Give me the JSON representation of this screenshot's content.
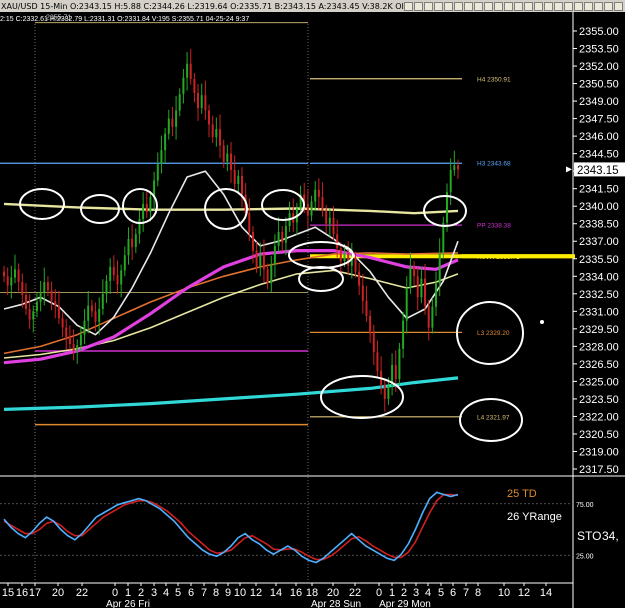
{
  "header": {
    "info": "XAU/USD 15-Min O:2343.15 H:5.88 C:2344.26 L:2319.64 O:2335.71 B:2343.15 A:2343.45 V:38.2K OI:",
    "sub": "2:15 C:2332.61 H:2332.79 L:2331.31 O:2331.84 V:195 S:2355.71 04-25-24 9:37",
    "icons": [
      "",
      "",
      "",
      "",
      "",
      "",
      "",
      "",
      "",
      "",
      "",
      "",
      "",
      "",
      "",
      "",
      "",
      "",
      "",
      "",
      "",
      ""
    ]
  },
  "colors": {
    "background": "#000000",
    "up_candle": "#22aa22",
    "down_candle": "#cc2222",
    "pivot_blue": "#5aa8ff",
    "pivot_magenta": "#d030d0",
    "pivot_orange": "#e08a30",
    "ma_white": "#e8e8e8",
    "ma_yellow": "#e6e6a0",
    "ma_magenta": "#e040e0",
    "ma_orange": "#e07030",
    "ma_cyan": "#30d8d8",
    "highlight_yellow": "#ffee00"
  },
  "chart_data": {
    "type": "candlestick",
    "title": "XAU/USD 15-Min",
    "ylim": [
      2317.5,
      2355.0
    ],
    "y_ticks": [
      "2355.00",
      "2353.50",
      "2352.00",
      "2350.50",
      "2349.00",
      "2347.50",
      "2346.00",
      "2344.50",
      "2343.00",
      "2341.50",
      "2340.00",
      "2338.50",
      "2337.00",
      "2335.50",
      "2334.00",
      "2332.50",
      "2331.00",
      "2329.50",
      "2328.00",
      "2326.50",
      "2325.00",
      "2323.50",
      "2322.00",
      "2320.50",
      "2319.00",
      "2317.50"
    ],
    "y_tick_values": [
      2355.0,
      2353.5,
      2352.0,
      2350.5,
      2349.0,
      2347.5,
      2346.0,
      2344.5,
      2343.0,
      2341.5,
      2340.0,
      2338.5,
      2337.0,
      2335.5,
      2334.0,
      2332.5,
      2331.0,
      2329.5,
      2328.0,
      2326.5,
      2325.0,
      2323.5,
      2322.0,
      2320.5,
      2319.0,
      2317.5
    ],
    "last_price": "2343.15",
    "last_price_value": 2343.15,
    "x_tick_labels": [
      "15",
      "16",
      "17",
      "20",
      "22",
      "0",
      "1",
      "2",
      "3",
      "4",
      "5",
      "6",
      "7",
      "8",
      "9",
      "10",
      "12",
      "14",
      "16",
      "18",
      "20",
      "22",
      "0",
      "1",
      "2",
      "3",
      "4",
      "5",
      "6",
      "7",
      "8",
      "10",
      "12",
      "14"
    ],
    "date_labels": [
      "Apr 26 Fri",
      "Apr 28 Sun",
      "Apr 29 Mon"
    ],
    "top_label": "2355.71",
    "pivots": [
      {
        "label": "H4 2350.91",
        "value": 2350.91,
        "color": "#d9c27a"
      },
      {
        "label": "H3 2343.68",
        "value": 2343.68,
        "color": "#5aa8ff"
      },
      {
        "label": "PP 2338.38",
        "value": 2338.38,
        "color": "#d030d0"
      },
      {
        "label": "R0VR 2335.71",
        "value": 2335.71,
        "color": "#ffee00"
      },
      {
        "label": "L3 2329.20",
        "value": 2329.2,
        "color": "#e08a30"
      },
      {
        "label": "L4 2321.97",
        "value": 2321.97,
        "color": "#d9c27a"
      }
    ],
    "prior_levels": [
      {
        "value": 2343.68,
        "color": "#5aa8ff"
      },
      {
        "value": 2327.6,
        "color": "#d030d0"
      },
      {
        "value": 2332.6,
        "color": "#d9c27a"
      },
      {
        "value": 2321.3,
        "color": "#e08a30"
      },
      {
        "value": 2355.71,
        "color": "#d9c27a"
      }
    ],
    "candles": [
      2334.0,
      2333.2,
      2333.9,
      2334.6,
      2333.5,
      2332.4,
      2331.2,
      2330.3,
      2331.0,
      2331.8,
      2332.6,
      2333.5,
      2332.8,
      2331.9,
      2331.5,
      2330.4,
      2329.6,
      2328.8,
      2328.2,
      2327.6,
      2328.1,
      2329.0,
      2330.2,
      2331.5,
      2331.0,
      2330.1,
      2331.2,
      2332.5,
      2333.6,
      2334.8,
      2334.1,
      2333.3,
      2334.5,
      2335.8,
      2337.2,
      2336.5,
      2337.6,
      2338.9,
      2340.2,
      2339.5,
      2340.8,
      2342.2,
      2343.6,
      2344.8,
      2346.2,
      2347.5,
      2346.8,
      2348.2,
      2349.6,
      2351.0,
      2352.2,
      2350.9,
      2349.7,
      2348.4,
      2349.5,
      2348.2,
      2347.0,
      2345.9,
      2346.6,
      2345.2,
      2343.8,
      2344.5,
      2343.1,
      2341.9,
      2342.6,
      2341.0,
      2339.4,
      2337.8,
      2336.2,
      2334.8,
      2335.9,
      2334.6,
      2333.4,
      2335.0,
      2336.6,
      2337.8,
      2336.9,
      2338.3,
      2339.4,
      2338.6,
      2339.8,
      2341.0,
      2340.2,
      2339.2,
      2340.4,
      2341.4,
      2340.8,
      2339.6,
      2338.5,
      2339.0,
      2337.6,
      2336.4,
      2335.3,
      2336.0,
      2334.9,
      2335.6,
      2334.4,
      2333.2,
      2331.9,
      2330.6,
      2329.1,
      2327.5,
      2325.9,
      2324.7,
      2323.5,
      2324.6,
      2326.4,
      2325.2,
      2327.8,
      2330.2,
      2333.0,
      2334.8,
      2334.0,
      2332.2,
      2333.8,
      2331.5,
      2329.6,
      2331.4,
      2333.4,
      2336.0,
      2338.6,
      2341.2,
      2343.1,
      2343.5,
      2343.15
    ],
    "ma_white": [
      [
        2331.2,
        0
      ],
      [
        2331.6,
        5
      ],
      [
        2332.2,
        10
      ],
      [
        2331.4,
        15
      ],
      [
        2329.8,
        20
      ],
      [
        2329.0,
        25
      ],
      [
        2330.5,
        30
      ],
      [
        2333.0,
        35
      ],
      [
        2336.0,
        40
      ],
      [
        2339.4,
        45
      ],
      [
        2342.5,
        50
      ],
      [
        2343.0,
        55
      ],
      [
        2341.0,
        60
      ],
      [
        2338.2,
        65
      ],
      [
        2336.6,
        70
      ],
      [
        2337.0,
        75
      ],
      [
        2337.6,
        80
      ],
      [
        2338.2,
        85
      ],
      [
        2337.2,
        90
      ],
      [
        2336.0,
        95
      ],
      [
        2334.4,
        100
      ],
      [
        2332.2,
        105
      ],
      [
        2330.4,
        110
      ],
      [
        2331.2,
        115
      ],
      [
        2333.6,
        120
      ],
      [
        2337.0,
        124
      ]
    ],
    "ma_yellow": [
      [
        2327.0,
        0
      ],
      [
        2327.3,
        10
      ],
      [
        2327.8,
        20
      ],
      [
        2328.5,
        30
      ],
      [
        2329.6,
        40
      ],
      [
        2330.9,
        50
      ],
      [
        2332.2,
        60
      ],
      [
        2333.3,
        70
      ],
      [
        2334.2,
        80
      ],
      [
        2334.5,
        90
      ],
      [
        2333.8,
        100
      ],
      [
        2333.0,
        110
      ],
      [
        2333.5,
        118
      ],
      [
        2334.2,
        124
      ]
    ],
    "ma_magenta": [
      [
        2326.6,
        0
      ],
      [
        2326.9,
        10
      ],
      [
        2327.6,
        20
      ],
      [
        2328.8,
        30
      ],
      [
        2330.8,
        40
      ],
      [
        2333.0,
        50
      ],
      [
        2334.8,
        60
      ],
      [
        2335.9,
        70
      ],
      [
        2336.2,
        80
      ],
      [
        2336.2,
        90
      ],
      [
        2335.6,
        100
      ],
      [
        2334.8,
        110
      ],
      [
        2334.6,
        118
      ],
      [
        2335.4,
        124
      ]
    ],
    "ma_orange": [
      [
        2327.4,
        0
      ],
      [
        2328.0,
        10
      ],
      [
        2329.0,
        20
      ],
      [
        2330.4,
        30
      ],
      [
        2331.8,
        40
      ],
      [
        2333.0,
        50
      ],
      [
        2334.0,
        60
      ],
      [
        2334.8,
        70
      ],
      [
        2335.4,
        80
      ],
      [
        2335.9,
        90
      ],
      [
        2336.0,
        100
      ],
      [
        2335.9,
        110
      ],
      [
        2336.0,
        124
      ]
    ],
    "ma_yellow_long": [
      [
        2340.2,
        0
      ],
      [
        2339.9,
        20
      ],
      [
        2339.7,
        40
      ],
      [
        2339.7,
        60
      ],
      [
        2339.8,
        80
      ],
      [
        2339.6,
        100
      ],
      [
        2339.4,
        112
      ],
      [
        2339.6,
        124
      ]
    ],
    "ma_cyan": [
      [
        2322.6,
        0
      ],
      [
        2322.8,
        20
      ],
      [
        2323.1,
        40
      ],
      [
        2323.5,
        60
      ],
      [
        2323.9,
        80
      ],
      [
        2324.4,
        100
      ],
      [
        2324.9,
        112
      ],
      [
        2325.3,
        124
      ]
    ],
    "sto_label": "STO",
    "sto_value": "34,",
    "td_label": "25 TD",
    "yrange_label": "26 YRange",
    "sto_ticks": [
      "75.00",
      "25.00"
    ],
    "sto_k": [
      60,
      52,
      46,
      42,
      48,
      56,
      62,
      58,
      50,
      44,
      40,
      46,
      54,
      62,
      66,
      70,
      74,
      76,
      78,
      80,
      78,
      74,
      70,
      64,
      58,
      50,
      42,
      36,
      30,
      26,
      24,
      28,
      34,
      42,
      46,
      40,
      36,
      30,
      26,
      30,
      34,
      30,
      24,
      20,
      18,
      22,
      28,
      34,
      40,
      46,
      40,
      34,
      30,
      26,
      22,
      20,
      26,
      36,
      50,
      66,
      80,
      86,
      84,
      82,
      84
    ],
    "sto_d": [
      58,
      54,
      50,
      46,
      46,
      50,
      56,
      58,
      54,
      48,
      44,
      44,
      50,
      56,
      62,
      66,
      70,
      74,
      76,
      78,
      78,
      76,
      72,
      68,
      62,
      56,
      48,
      42,
      36,
      30,
      27,
      28,
      30,
      36,
      42,
      44,
      40,
      36,
      31,
      30,
      31,
      31,
      28,
      24,
      21,
      21,
      24,
      29,
      35,
      41,
      43,
      39,
      34,
      30,
      26,
      23,
      23,
      28,
      38,
      52,
      66,
      78,
      84,
      84,
      83
    ]
  }
}
